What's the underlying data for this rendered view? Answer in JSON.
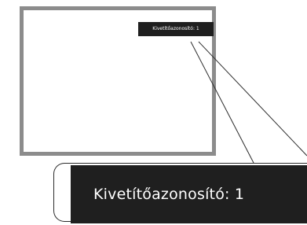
{
  "screen_preview": {
    "identifier_label": "Kivetítőazonosító: 1"
  },
  "zoom_callout": {
    "identifier_label": "Kivetítőazonosító:  1"
  },
  "colors": {
    "frame": "#8c8c8c",
    "badge_background": "#1f1f1f",
    "badge_text": "#ffffff",
    "callout_outline": "#2b2b2b"
  }
}
